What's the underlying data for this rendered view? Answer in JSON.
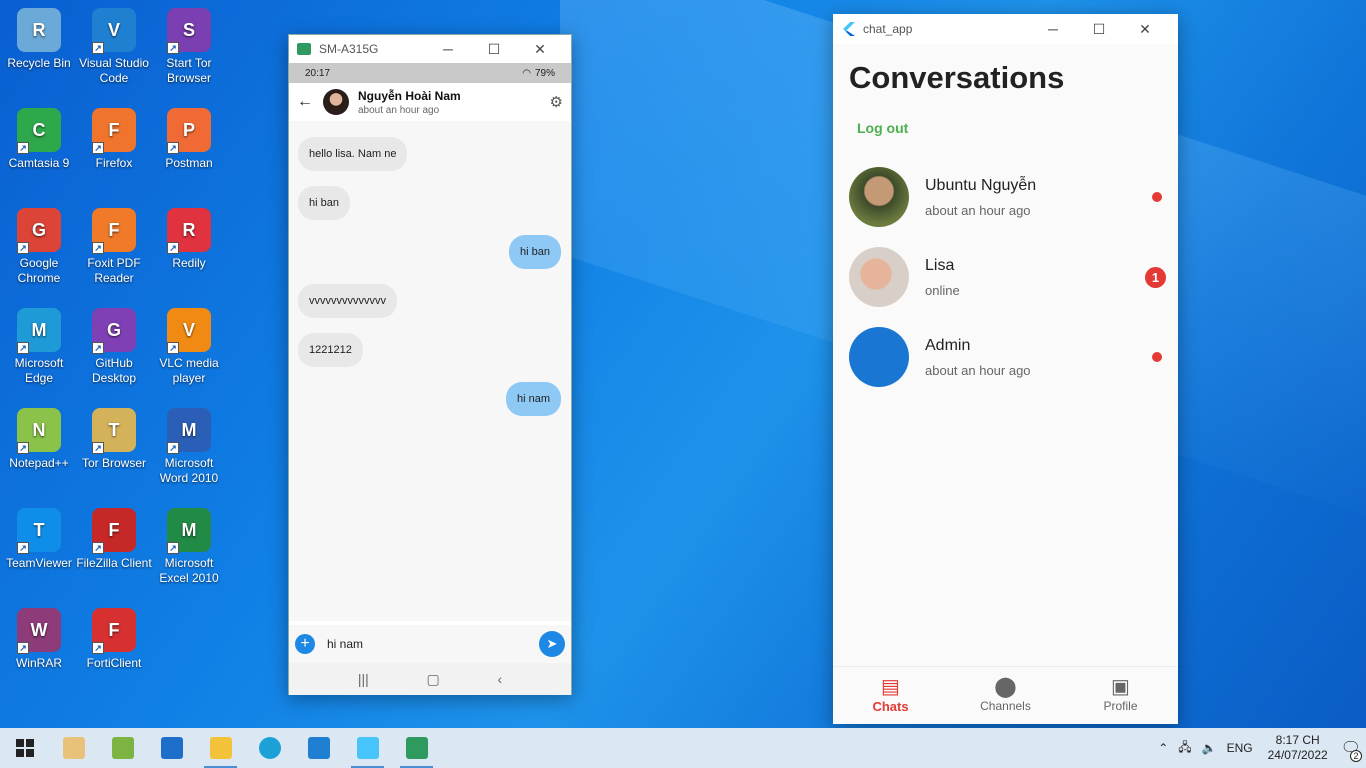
{
  "desktop": {
    "icons": [
      {
        "label": "Recycle Bin",
        "color": "#6aa9d8"
      },
      {
        "label": "Visual Studio Code",
        "color": "#1f7fd1"
      },
      {
        "label": "Start Tor Browser",
        "color": "#7a3fb0"
      },
      {
        "label": "Camtasia 9",
        "color": "#2ea84b"
      },
      {
        "label": "Firefox",
        "color": "#f0742b"
      },
      {
        "label": "Postman",
        "color": "#f06a35"
      },
      {
        "label": "Google Chrome",
        "color": "#db4437"
      },
      {
        "label": "Foxit PDF Reader",
        "color": "#f07a28"
      },
      {
        "label": "Redily",
        "color": "#e0323f"
      },
      {
        "label": "Microsoft Edge",
        "color": "#1e9ad6"
      },
      {
        "label": "GitHub Desktop",
        "color": "#7f3fb5"
      },
      {
        "label": "VLC media player",
        "color": "#f08a12"
      },
      {
        "label": "Notepad++",
        "color": "#8bc34a"
      },
      {
        "label": "Tor Browser",
        "color": "#d4b25a"
      },
      {
        "label": "Microsoft Word 2010",
        "color": "#2b5fb7"
      },
      {
        "label": "TeamViewer",
        "color": "#0e8ee9"
      },
      {
        "label": "FileZilla Client",
        "color": "#c62828"
      },
      {
        "label": "Microsoft Excel 2010",
        "color": "#218a45"
      },
      {
        "label": "WinRAR",
        "color": "#8e3b7a"
      },
      {
        "label": "FortiClient",
        "color": "#d63030"
      }
    ]
  },
  "phone_window": {
    "title": "SM-A315G",
    "status_time": "20:17",
    "status_battery": "79%",
    "contact_name": "Nguyễn Hoài Nam",
    "contact_status": "about an hour ago",
    "messages": [
      {
        "text": "hello lisa. Nam ne",
        "dir": "in"
      },
      {
        "text": "hi ban",
        "dir": "in"
      },
      {
        "text": "hi ban",
        "dir": "out"
      },
      {
        "text": "vvvvvvvvvvvvvv",
        "dir": "in"
      },
      {
        "text": "1221212",
        "dir": "in"
      },
      {
        "text": "hi nam",
        "dir": "out"
      }
    ],
    "input_value": "hi nam"
  },
  "app_window": {
    "title": "chat_app",
    "heading": "Conversations",
    "logout_label": "Log out",
    "conversations": [
      {
        "name": "Ubuntu Nguyễn",
        "status": "about an hour ago",
        "indicator": "dot"
      },
      {
        "name": "Lisa",
        "status": "online",
        "indicator": "badge",
        "badge": "1"
      },
      {
        "name": "Admin",
        "status": "about an hour ago",
        "indicator": "dot"
      }
    ],
    "nav": [
      {
        "label": "Chats",
        "icon": "chat-icon",
        "active": true
      },
      {
        "label": "Channels",
        "icon": "channels-icon",
        "active": false
      },
      {
        "label": "Profile",
        "icon": "profile-icon",
        "active": false
      }
    ]
  },
  "taskbar": {
    "language": "ENG",
    "time": "8:17 CH",
    "date": "24/07/2022",
    "notification_count": "2"
  }
}
